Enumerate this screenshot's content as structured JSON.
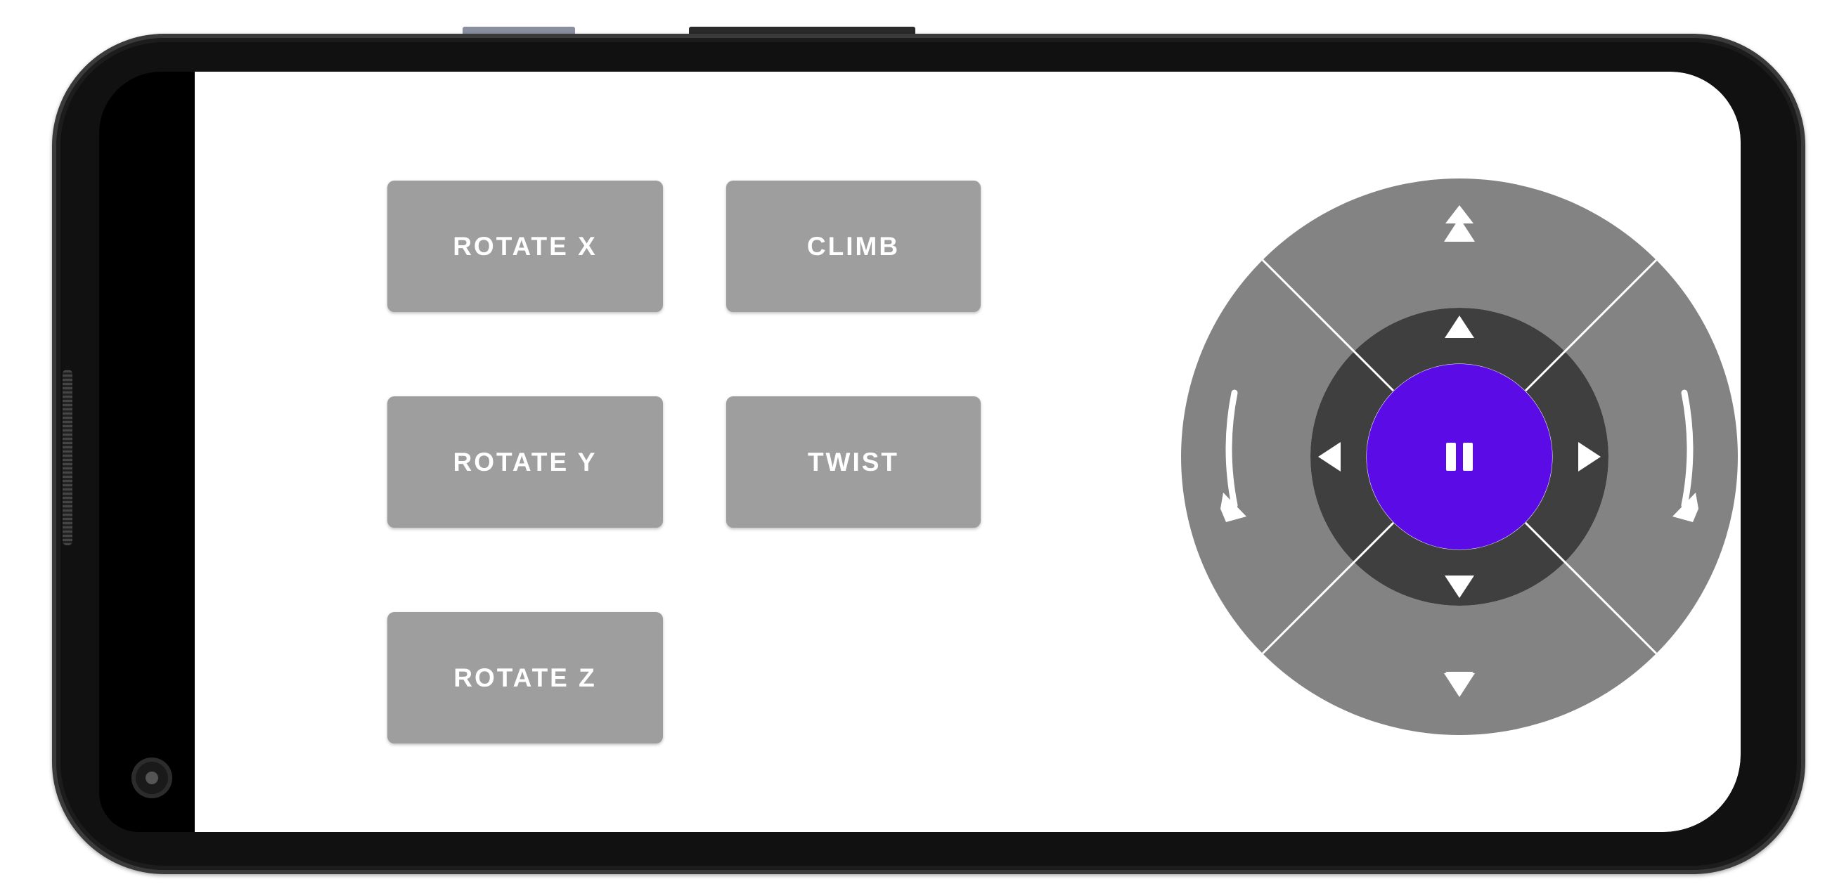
{
  "device": {
    "hardware_buttons": [
      "volume-button",
      "power-button"
    ]
  },
  "buttons": {
    "rotate_x": "ROTATE X",
    "climb": "CLIMB",
    "rotate_y": "ROTATE Y",
    "twist": "TWIST",
    "rotate_z": "ROTATE Z"
  },
  "dpad": {
    "outer_ring_color": "#838383",
    "inner_ring_color": "#3f3f3f",
    "center_color": "#5a0be6",
    "icon_color": "#ffffff",
    "icons": {
      "outer_up": "double-arrow-up-icon",
      "outer_down": "double-arrow-down-icon",
      "outer_left": "rotate-counterclockwise-icon",
      "outer_right": "rotate-clockwise-icon",
      "inner_up": "arrow-up-icon",
      "inner_down": "arrow-down-icon",
      "inner_left": "arrow-left-icon",
      "inner_right": "arrow-right-icon",
      "center": "pause-icon"
    }
  }
}
